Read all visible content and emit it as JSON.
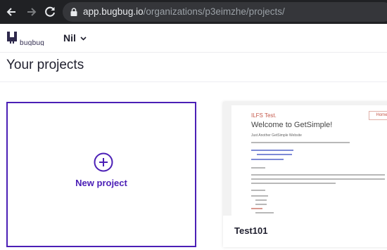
{
  "browser": {
    "url_host": "app.bugbug.io",
    "url_path": "/organizations/p3eimzhe/projects/"
  },
  "header": {
    "logo_text": "bugbug",
    "workspace_name": "Nil"
  },
  "page": {
    "title": "Your projects"
  },
  "new_project": {
    "label": "New project"
  },
  "projects": [
    {
      "name": "Test101",
      "thumbnail": {
        "site_name": "ILFS Test.",
        "nav_home": "Home",
        "heading": "Welcome to GetSimple!",
        "subtitle": "Just Another GetSimple Website"
      }
    }
  ],
  "colors": {
    "accent": "#4b1fb6",
    "browser_bar": "#202124",
    "text": "#1f1f2e"
  }
}
